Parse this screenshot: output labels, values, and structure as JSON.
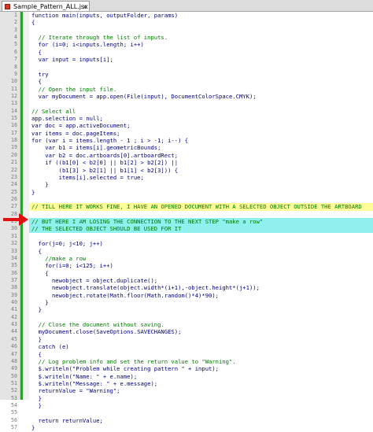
{
  "tab": {
    "label": "Sample_Pattern_ALL.jsx",
    "close": "x"
  },
  "lines": [
    {
      "n": "1",
      "text": "function main(inputs, outputFolder, params)",
      "style": "code"
    },
    {
      "n": "2",
      "text": "{",
      "style": "code"
    },
    {
      "n": "3",
      "text": "",
      "style": "code"
    },
    {
      "n": "4",
      "text": "  // Iterate through the list of inputs.",
      "style": "comment"
    },
    {
      "n": "5",
      "text": "  for (i=0; i<inputs.length; i++)",
      "style": "code"
    },
    {
      "n": "6",
      "text": "  {",
      "style": "code"
    },
    {
      "n": "7",
      "text": "  var input = inputs[i];",
      "style": "code"
    },
    {
      "n": "8",
      "text": "",
      "style": "code"
    },
    {
      "n": "9",
      "text": "  try",
      "style": "code"
    },
    {
      "n": "10",
      "text": "  {",
      "style": "code"
    },
    {
      "n": "11",
      "text": "  // Open the input file.",
      "style": "comment"
    },
    {
      "n": "12",
      "text": "  var myDocument = app.open(File(input), DocumentColorSpace.CMYK);",
      "style": "code"
    },
    {
      "n": "13",
      "text": "",
      "style": "code"
    },
    {
      "n": "14",
      "text": "// Select all",
      "style": "comment"
    },
    {
      "n": "15",
      "text": "app.selection = null;",
      "style": "code"
    },
    {
      "n": "16",
      "text": "var doc = app.activeDocument;",
      "style": "code"
    },
    {
      "n": "17",
      "text": "var items = doc.pageItems;",
      "style": "code"
    },
    {
      "n": "18",
      "text": "for (var i = items.length - 1 ; i > -1; i--) {",
      "style": "code"
    },
    {
      "n": "19",
      "text": "    var b1 = items[i].geometricBounds;",
      "style": "code"
    },
    {
      "n": "20",
      "text": "    var b2 = doc.artboards[0].artboardRect;",
      "style": "code"
    },
    {
      "n": "21",
      "text": "    if ((b1[0] < b2[0] || b1[2] > b2[2]) ||",
      "style": "code"
    },
    {
      "n": "22",
      "text": "        (b1[3] > b2[1] || b1[1] < b2[3])) {",
      "style": "code"
    },
    {
      "n": "23",
      "text": "        items[i].selected = true;",
      "style": "code"
    },
    {
      "n": "24",
      "text": "    }",
      "style": "code"
    },
    {
      "n": "25",
      "text": "}",
      "style": "code"
    },
    {
      "n": "26",
      "text": "",
      "style": "code"
    },
    {
      "n": "27",
      "text": "// TILL HERE IT WORKS FINE, I HAVE AN OPENED DOCUMENT WITH A SELECTED OBJECT OUTSIDE THE ARTBOARD",
      "style": "yellow"
    },
    {
      "n": "28",
      "text": "",
      "style": "code"
    },
    {
      "n": "29",
      "text": "// BUT HERE I AM LOSING THE CONNECTION TO THE NEXT STEP \"make a row\"",
      "style": "cyan"
    },
    {
      "n": "30",
      "text": "// THE SELECTED OBJECT SHOULD BE USED FOR IT",
      "style": "cyan"
    },
    {
      "n": "31",
      "text": "",
      "style": "code"
    },
    {
      "n": "32",
      "text": "  for(j=0; j<10; j++)",
      "style": "code"
    },
    {
      "n": "33",
      "text": "  {",
      "style": "code"
    },
    {
      "n": "34",
      "text": "    //make a row",
      "style": "comment"
    },
    {
      "n": "35",
      "text": "    for(i=0; i<125; i++)",
      "style": "code"
    },
    {
      "n": "36",
      "text": "    {",
      "style": "code"
    },
    {
      "n": "37",
      "text": "      newobject = object.duplicate();",
      "style": "code"
    },
    {
      "n": "38",
      "text": "      newobject.translate(object.width*(i+1),-object.height*(j+1));",
      "style": "code"
    },
    {
      "n": "39",
      "text": "      newobject.rotate(Math.floor(Math.random()*4)*90);",
      "style": "code"
    },
    {
      "n": "40",
      "text": "    }",
      "style": "code"
    },
    {
      "n": "41",
      "text": "  }",
      "style": "code"
    },
    {
      "n": "42",
      "text": "",
      "style": "code"
    },
    {
      "n": "43",
      "text": "  // Close the document without saving.",
      "style": "comment"
    },
    {
      "n": "44",
      "text": "  myDocument.close(SaveOptions.SAVECHANGES);",
      "style": "code"
    },
    {
      "n": "45",
      "text": "  }",
      "style": "code"
    },
    {
      "n": "46",
      "text": "  catch (e)",
      "style": "code"
    },
    {
      "n": "47",
      "text": "  {",
      "style": "code"
    },
    {
      "n": "48",
      "text": "  // Log problem info and set the return value to \"Warning\".",
      "style": "comment"
    },
    {
      "n": "49",
      "text": "  $.writeln(\"Problem while creating pattern \" + input);",
      "style": "code"
    },
    {
      "n": "50",
      "text": "  $.writeln(\"Name: \" + e.name);",
      "style": "code"
    },
    {
      "n": "51",
      "text": "  $.writeln(\"Message: \" + e.message);",
      "style": "code"
    },
    {
      "n": "52",
      "text": "  returnValue = \"Warning\";",
      "style": "code"
    },
    {
      "n": "53",
      "text": "  }",
      "style": "code"
    },
    {
      "n": "54",
      "text": "  }",
      "style": "code"
    },
    {
      "n": "55",
      "text": "",
      "style": "code"
    },
    {
      "n": "56",
      "text": "  return returnValue;",
      "style": "code"
    },
    {
      "n": "57",
      "text": "}",
      "style": "code"
    }
  ],
  "colors": {
    "keyword": "#0000ff",
    "comment": "#007a00",
    "yellow_highlight": "#ffff9a",
    "cyan_highlight": "#8ff0ee",
    "arrow": "#e01010",
    "change_marker": "#2da02d"
  },
  "icons": {
    "tab": "save-icon",
    "arrow": "red-arrow-annotation"
  }
}
